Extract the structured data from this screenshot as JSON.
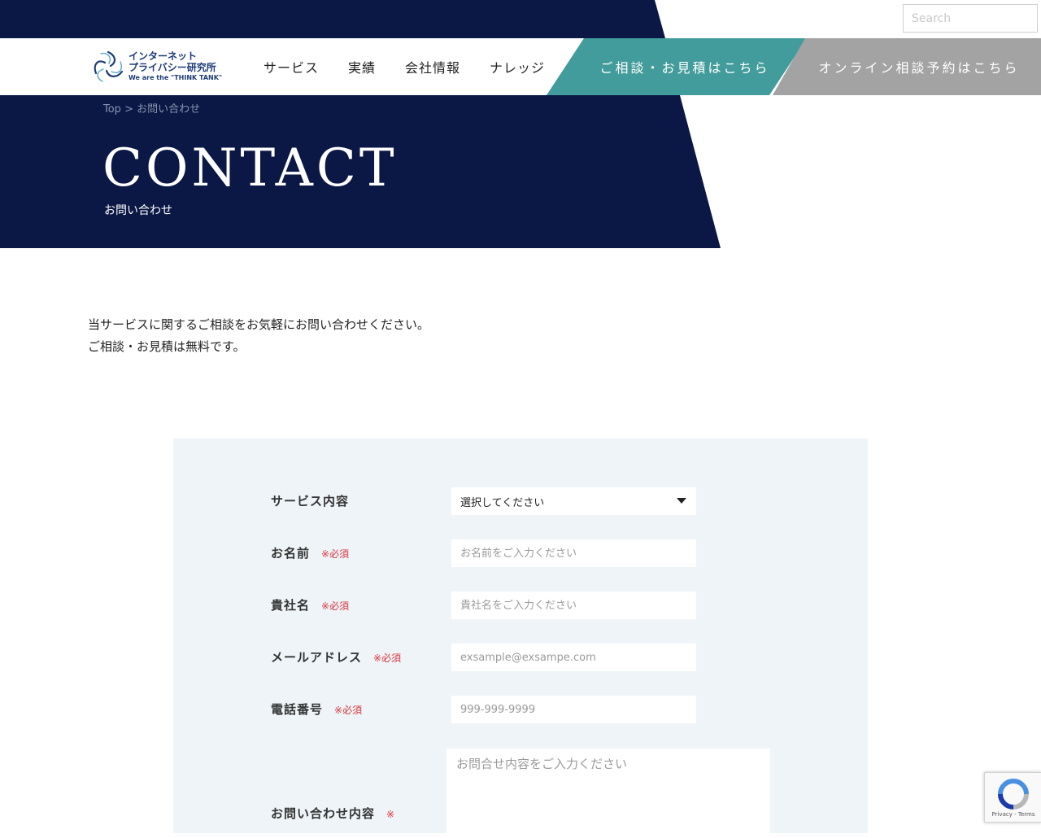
{
  "search": {
    "placeholder": "Search"
  },
  "header": {
    "logo_line1": "インターネット",
    "logo_line2": "プライバシー研究所",
    "logo_sub": "We are the \"THINK TANK\"",
    "nav": [
      "サービス",
      "実績",
      "会社情報",
      "ナレッジ"
    ],
    "cta_consult": "ご相談・お見積はこちら",
    "cta_online": "オンライン相談予約はこちら"
  },
  "colors": {
    "navy": "#0b1845",
    "teal": "#429c9b",
    "gray": "#a3a3a3",
    "panel": "#eef4f8",
    "required": "#d9363e"
  },
  "breadcrumb": {
    "home": "Top",
    "separator": ">",
    "current": "お問い合わせ"
  },
  "hero": {
    "title": "CONTACT",
    "subtitle": "お問い合わせ"
  },
  "intro": {
    "line1": "当サービスに関するご相談をお気軽にお問い合わせください。",
    "line2": "ご相談・お見積は無料です。"
  },
  "form": {
    "service": {
      "label": "サービス内容",
      "value": "選択してください"
    },
    "name": {
      "label": "お名前",
      "required": "※必須",
      "placeholder": "お名前をご入力ください"
    },
    "company": {
      "label": "貴社名",
      "required": "※必須",
      "placeholder": "貴社名をご入力ください"
    },
    "email": {
      "label": "メールアドレス",
      "required": "※必須",
      "placeholder": "exsample@exsampe.com"
    },
    "phone": {
      "label": "電話番号",
      "required": "※必須",
      "placeholder": "999-999-9999"
    },
    "message": {
      "label": "お問い合わせ内容",
      "required": "※",
      "placeholder": "お問合せ内容をご入力ください"
    }
  },
  "recaptcha": {
    "privacy": "Privacy",
    "separator": " - ",
    "terms": "Terms"
  }
}
